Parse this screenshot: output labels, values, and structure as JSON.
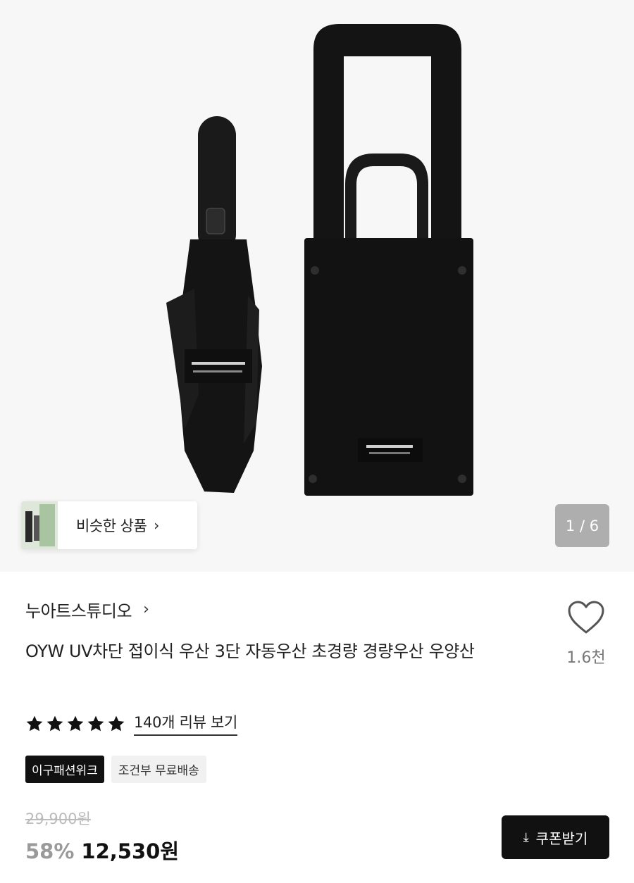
{
  "gallery": {
    "similar_label": "비슷한 상품",
    "pager": "1 / 6"
  },
  "product": {
    "brand": "누아트스튜디오",
    "title": "OYW UV차단 접이식 우산 3단 자동우산 초경량 경량우산 우양산",
    "like_count": "1.6천",
    "rating": 5,
    "review_link": "140개 리뷰 보기",
    "badges": [
      "이구패션위크",
      "조건부 무료배송"
    ],
    "original_price": "29,900원",
    "discount": "58%",
    "sale_price": "12,530원",
    "coupon_label": "쿠폰받기"
  },
  "icons": {
    "similar_chevron": "chevron-right-icon",
    "brand_chevron": "chevron-right-icon",
    "like": "heart-outline-icon",
    "star": "star-filled-icon",
    "coupon": "download-icon"
  },
  "colors": {
    "accent_dark": "#111111",
    "discount": "#9a9a9a",
    "badge_light_bg": "#f1f1f1"
  }
}
